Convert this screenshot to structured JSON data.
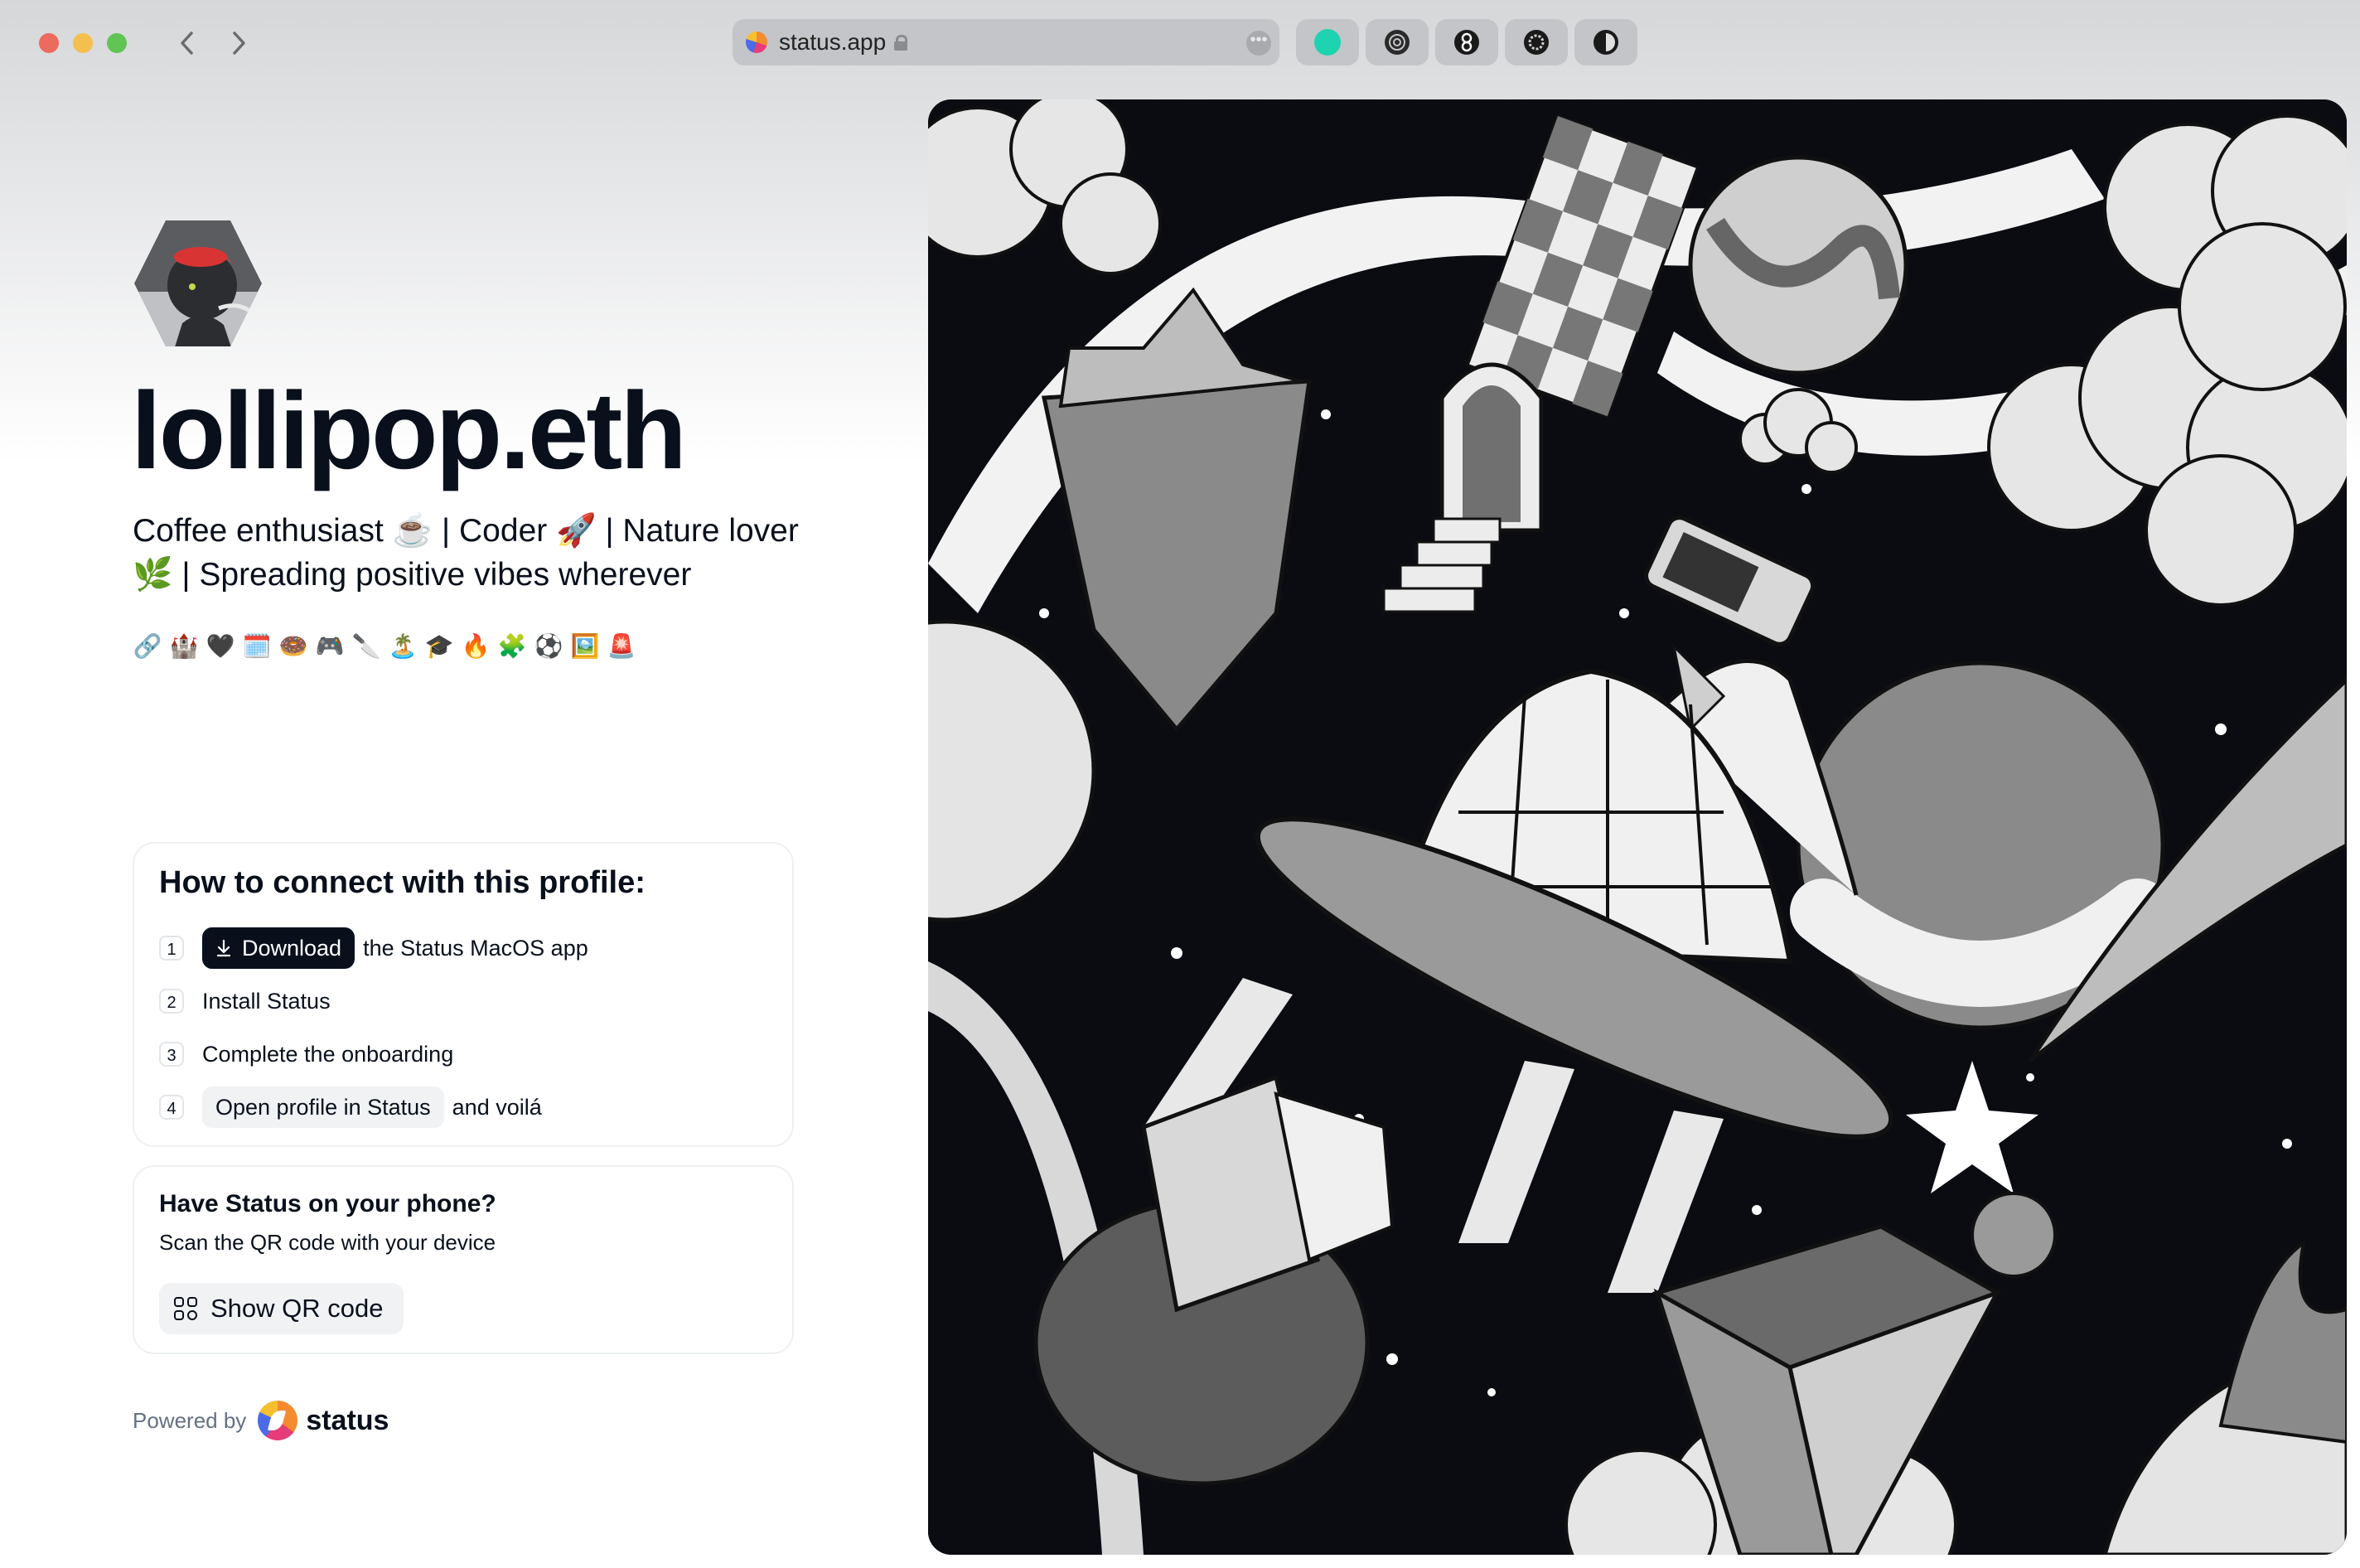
{
  "browser": {
    "url": "status.app",
    "more_label": "•••",
    "extension_colors": [
      "#1ed3b0",
      "#2a2a2a",
      "#1a1a1a",
      "#1a1a1a",
      "#1a1a1a"
    ]
  },
  "profile": {
    "display_name": "lollipop.eth",
    "bio": "Coffee enthusiast ☕️ | Coder 🚀 | Nature lover 🌿 | Spreading positive vibes wherever",
    "tags": [
      "🔗",
      "🏰",
      "🖤",
      "🗓️",
      "🍩",
      "🎮",
      "🔪",
      "🏝️",
      "🎓",
      "🔥",
      "🧩",
      "⚽",
      "🖼️",
      "🚨"
    ]
  },
  "connect": {
    "title": "How to connect with this profile:",
    "steps": [
      {
        "num": "1",
        "button": "Download",
        "text": "the Status MacOS app"
      },
      {
        "num": "2",
        "text": "Install Status"
      },
      {
        "num": "3",
        "text": "Complete the onboarding"
      },
      {
        "num": "4",
        "button": "Open profile in Status",
        "text": "and voilá"
      }
    ]
  },
  "phone": {
    "title": "Have Status on your phone?",
    "subtitle": "Scan the QR code with your device",
    "qr_button": "Show QR code"
  },
  "footer": {
    "powered_by": "Powered by",
    "brand": "status"
  },
  "colors": {
    "text": "#09101c",
    "muted": "#647084",
    "dark_button": "#09101c",
    "light_button": "#f0f2f4",
    "card_border": "#eef0f2"
  }
}
